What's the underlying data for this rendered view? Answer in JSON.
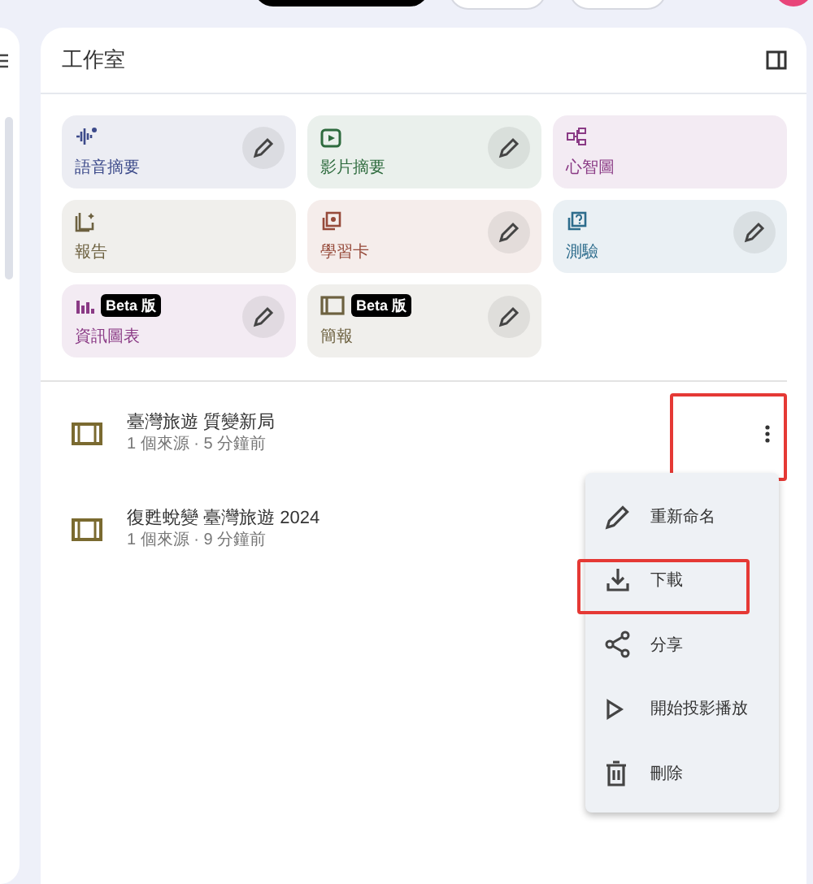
{
  "studio": {
    "title": "工作室",
    "tiles": [
      {
        "kind": "audio",
        "label": "語音摘要",
        "color": "#3c4a8a",
        "editable": true
      },
      {
        "kind": "video",
        "label": "影片摘要",
        "color": "#2e6b3e",
        "editable": true
      },
      {
        "kind": "mindmap",
        "label": "心智圖",
        "color": "#8a3a85",
        "editable": false
      },
      {
        "kind": "report",
        "label": "報告",
        "color": "#6d6140",
        "editable": false
      },
      {
        "kind": "flashcards",
        "label": "學習卡",
        "color": "#964a3a",
        "editable": true
      },
      {
        "kind": "quiz",
        "label": "測驗",
        "color": "#2d6c8c",
        "editable": true
      },
      {
        "kind": "infographic",
        "label": "資訊圖表",
        "color": "#8a3a85",
        "editable": true,
        "beta": "Beta 版"
      },
      {
        "kind": "slides",
        "label": "簡報",
        "color": "#6d6140",
        "editable": true,
        "beta": "Beta 版"
      }
    ],
    "artifacts": [
      {
        "title": "臺灣旅遊 質變新局",
        "meta": "1 個來源 · 5 分鐘前",
        "more_shown": true,
        "highlighted": true
      },
      {
        "title": "復甦蛻變 臺灣旅遊 2024",
        "meta": "1 個來源 · 9 分鐘前",
        "more_shown": false,
        "highlighted": false
      }
    ],
    "menu": {
      "items": [
        {
          "kind": "rename",
          "label": "重新命名",
          "highlighted": false
        },
        {
          "kind": "download",
          "label": "下載",
          "highlighted": true
        },
        {
          "kind": "share",
          "label": "分享",
          "highlighted": false
        },
        {
          "kind": "present",
          "label": "開始投影播放",
          "highlighted": false
        },
        {
          "kind": "delete",
          "label": "刪除",
          "highlighted": false
        }
      ]
    }
  }
}
